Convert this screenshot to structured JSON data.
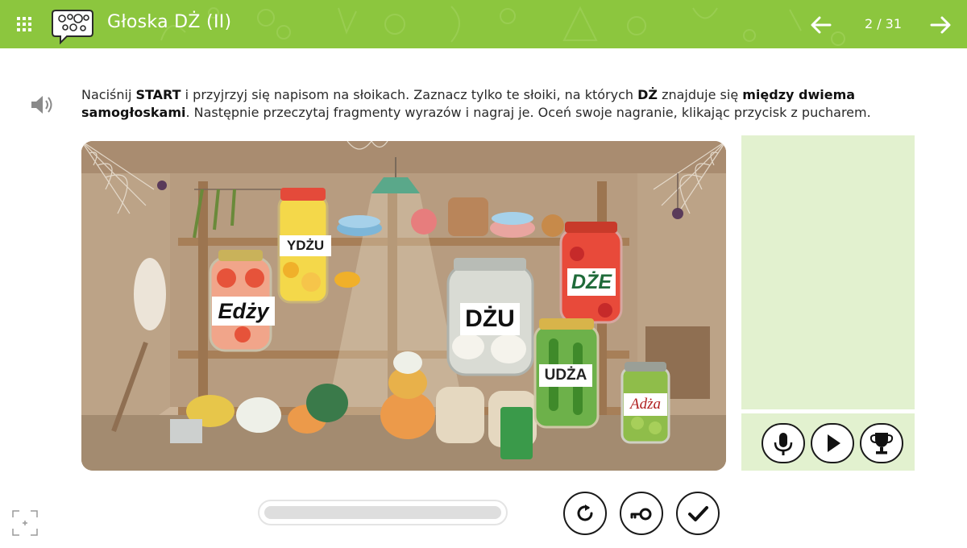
{
  "header": {
    "title": "Głoska DŻ (II)",
    "page_counter": "2 / 31",
    "apps_icon": "grid-dots-icon",
    "logo_icon": "speech-bubble-logo-icon",
    "prev_icon": "arrow-left-icon",
    "next_icon": "arrow-right-icon",
    "bg_color": "#8cc63e"
  },
  "instruction": {
    "p1": "Naciśnij ",
    "b1": "START",
    "p2": " i przyjrzyj się napisom na słoikach. Zaznacz tylko te słoiki, na których ",
    "b2": "DŻ",
    "p3": " znajduje się ",
    "b3": "między dwiema samogłoskami",
    "p4": ". Następnie przeczytaj fragmenty wyrazów i nagraj je. Oceń swoje nagranie, klikając przycisk z pucharem.",
    "speaker_icon": "speaker-icon"
  },
  "jars": [
    {
      "id": "ydzu",
      "label": "YDŻU"
    },
    {
      "id": "edzy",
      "label": "Edży"
    },
    {
      "id": "dzu",
      "label": "DŻU"
    },
    {
      "id": "dze",
      "label": "DŻE"
    },
    {
      "id": "udza",
      "label": "UDŻA"
    },
    {
      "id": "adza",
      "label": "Adża"
    }
  ],
  "recorder": {
    "mic_icon": "microphone-icon",
    "play_icon": "play-icon",
    "trophy_icon": "trophy-icon",
    "panel_color": "#e2f1cf"
  },
  "bottom": {
    "progress": 0,
    "reset_icon": "reset-icon",
    "key_icon": "key-icon",
    "check_icon": "checkmark-icon",
    "fullscreen_icon": "fullscreen-icon"
  }
}
